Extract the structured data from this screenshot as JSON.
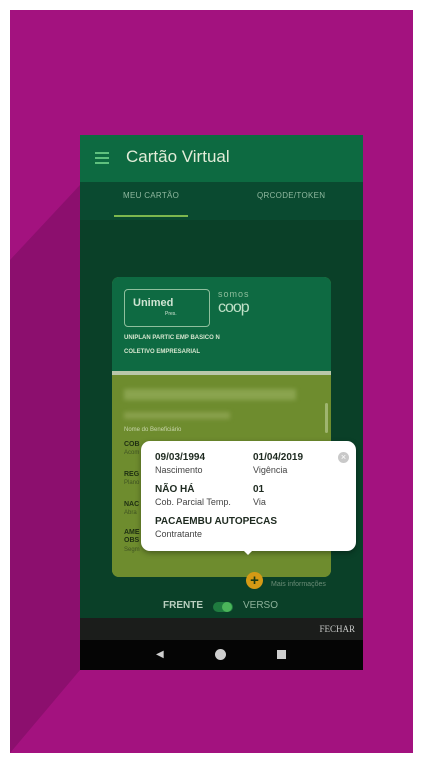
{
  "header": {
    "title": "Cartão Virtual",
    "menu_icon": "hamburger-icon"
  },
  "tabs": [
    {
      "label": "MEU CARTÃO",
      "active": true
    },
    {
      "label": "QRCODE/TOKEN",
      "active": false
    }
  ],
  "card": {
    "logo": {
      "brand": "Unimed",
      "sub": "Pres.",
      "somos": "somos",
      "coop": "coop"
    },
    "plan_name": "UNIPLAN PARTIC EMP BASICO N",
    "plan_type": "COLETIVO EMPRESARIAL",
    "beneficiary_label": "Nome do Beneficiário",
    "fields": [
      {
        "label": "COB",
        "sub": "Acom"
      },
      {
        "label": "REG",
        "sub": "Plano"
      },
      {
        "label": "NAC",
        "sub": "Abra"
      },
      {
        "label": "AME",
        "sub": ""
      },
      {
        "label": "OBS",
        "sub": "Segm"
      }
    ]
  },
  "popup": {
    "nascimento_value": "09/03/1994",
    "nascimento_label": "Nascimento",
    "vigencia_value": "01/04/2019",
    "vigencia_label": "Vigência",
    "cob_value": "NÃO HÁ",
    "cob_label": "Cob. Parcial Temp.",
    "via_value": "01",
    "via_label": "Via",
    "contratante_value": "PACAEMBU AUTOPECAS",
    "contratante_label": "Contratante",
    "close_symbol": "×"
  },
  "more_info": {
    "plus": "+",
    "label": "Mais informações"
  },
  "toggle": {
    "frente": "FRENTE",
    "verso": "VERSO",
    "state": "frente"
  },
  "bottom": {
    "fechar": "FECHAR"
  },
  "navbar": {
    "back": "◀",
    "home": "home",
    "recent": "recent"
  },
  "colors": {
    "background": "#a3127f",
    "app_bar": "#0d6a41",
    "card_body": "#6e8c2e",
    "accent": "#d49a15"
  }
}
